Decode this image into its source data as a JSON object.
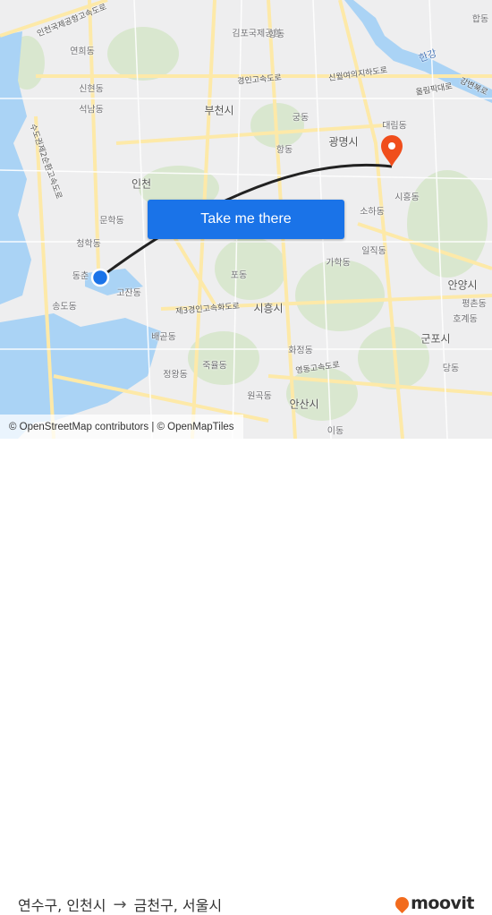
{
  "map": {
    "labels": [
      {
        "text": "인천국제공항고속도로",
        "type": "road"
      },
      {
        "text": "김포국제공항",
        "type": "place"
      },
      {
        "text": "연희동",
        "type": "place"
      },
      {
        "text": "경인고속도로",
        "type": "road"
      },
      {
        "text": "신월여의지하도로",
        "type": "road"
      },
      {
        "text": "한강",
        "type": "water"
      },
      {
        "text": "올림픽대로",
        "type": "road"
      },
      {
        "text": "강변북로",
        "type": "road"
      },
      {
        "text": "신현동",
        "type": "place"
      },
      {
        "text": "석남동",
        "type": "place"
      },
      {
        "text": "부천시",
        "type": "city"
      },
      {
        "text": "궁동",
        "type": "place"
      },
      {
        "text": "대림동",
        "type": "place"
      },
      {
        "text": "광명시",
        "type": "city"
      },
      {
        "text": "항동",
        "type": "place"
      },
      {
        "text": "수도권제2순환고속도로",
        "type": "road"
      },
      {
        "text": "인천",
        "type": "city"
      },
      {
        "text": "문학동",
        "type": "place"
      },
      {
        "text": "청학동",
        "type": "place"
      },
      {
        "text": "동춘",
        "type": "place"
      },
      {
        "text": "소하동",
        "type": "place"
      },
      {
        "text": "시흥동",
        "type": "place"
      },
      {
        "text": "일직동",
        "type": "place"
      },
      {
        "text": "가학동",
        "type": "place"
      },
      {
        "text": "포동",
        "type": "place"
      },
      {
        "text": "고잔동",
        "type": "place"
      },
      {
        "text": "제3경인고속화도로",
        "type": "road"
      },
      {
        "text": "시흥시",
        "type": "city"
      },
      {
        "text": "송도동",
        "type": "place"
      },
      {
        "text": "배곧동",
        "type": "place"
      },
      {
        "text": "안양시",
        "type": "city"
      },
      {
        "text": "평촌동",
        "type": "place"
      },
      {
        "text": "호계동",
        "type": "place"
      },
      {
        "text": "군포시",
        "type": "city"
      },
      {
        "text": "화정동",
        "type": "place"
      },
      {
        "text": "영동고속도로",
        "type": "road"
      },
      {
        "text": "죽율동",
        "type": "place"
      },
      {
        "text": "정왕동",
        "type": "place"
      },
      {
        "text": "당동",
        "type": "place"
      },
      {
        "text": "원곡동",
        "type": "place"
      },
      {
        "text": "안산시",
        "type": "city"
      },
      {
        "text": "항동",
        "type": "place"
      },
      {
        "text": "합동",
        "type": "place"
      },
      {
        "text": "이동",
        "type": "place"
      }
    ],
    "colors": {
      "water": "#aad3f5",
      "land": "#eeeeef",
      "park": "#d6e6cc",
      "road": "#fde9a8",
      "route": "#222222",
      "origin": "#1a73e8",
      "destination": "#f04e1c"
    },
    "origin_marker": "origin-dot",
    "destination_marker": "destination-pin-icon"
  },
  "cta": {
    "label": "Take me there"
  },
  "attribution": "© OpenStreetMap contributors | © OpenMapTiles",
  "route": {
    "from": "연수구, 인천시",
    "arrow": "→",
    "to": "금천구, 서울시"
  },
  "brand": {
    "name": "moovit",
    "color": "#f26b1d"
  }
}
